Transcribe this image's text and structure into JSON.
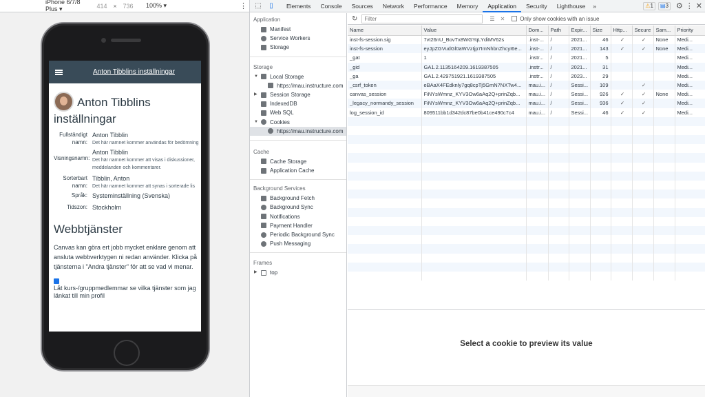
{
  "emulation": {
    "device": "iPhone 6/7/8 Plus ▾",
    "width": "414",
    "x": "×",
    "height": "736",
    "zoom": "100% ▾"
  },
  "phone_page": {
    "header_title": "Anton Tibblins inställningar",
    "title_line1": "Anton Tibblins",
    "title_line2": "inställningar",
    "fields": [
      {
        "label": "Fullständigt namn:",
        "value": "Anton Tibblin",
        "hint": "Det här namnet kommer användas för bedömning"
      },
      {
        "label": "Visningsnamn:",
        "value": "Anton Tibblin",
        "hint": "Det här namnet kommer att visas i diskussioner, meddelanden och kommentarer."
      },
      {
        "label": "Sorterbart namn:",
        "value": "Tibblin, Anton",
        "hint": "Det här namnet kommer att synas i sorterade lis"
      },
      {
        "label": "Språk:",
        "value": "Systeminställning (Svenska)",
        "hint": ""
      },
      {
        "label": "Tidszon:",
        "value": "Stockholm",
        "hint": ""
      }
    ],
    "web_heading": "Webbtjänster",
    "web_text_1": "Canvas kan göra ert jobb mycket enklare genom att",
    "web_text_2": "ansluta webbverktygen ni redan använder. Klicka på",
    "web_text_3": "tjänsterna i \"Andra tjänster\" för att se vad vi menar.",
    "checkbox_label_1": "Låt kurs-/gruppmedlemmar se vilka tjänster som jag",
    "checkbox_label_2": "länkat till min profil"
  },
  "devtools": {
    "tabs": [
      "Elements",
      "Console",
      "Sources",
      "Network",
      "Performance",
      "Memory",
      "Application",
      "Security",
      "Lighthouse"
    ],
    "more": "»",
    "warnings": "1",
    "messages": "3",
    "active_tab": "Application",
    "sidebar": {
      "application_header": "Application",
      "application_items": [
        "Manifest",
        "Service Workers",
        "Storage"
      ],
      "storage_header": "Storage",
      "local_storage": "Local Storage",
      "local_storage_child": "https://mau.instructure.com",
      "session_storage": "Session Storage",
      "indexeddb": "IndexedDB",
      "websql": "Web SQL",
      "cookies": "Cookies",
      "cookies_child": "https://mau.instructure.com",
      "cache_header": "Cache",
      "cache_items": [
        "Cache Storage",
        "Application Cache"
      ],
      "bg_header": "Background Services",
      "bg_items": [
        "Background Fetch",
        "Background Sync",
        "Notifications",
        "Payment Handler",
        "Periodic Background Sync",
        "Push Messaging"
      ],
      "frames_header": "Frames",
      "frames_top": "top"
    },
    "filter_placeholder": "Filter",
    "only_issue_label": "Only show cookies with an issue",
    "columns": [
      "Name",
      "Value",
      "Dom...",
      "Path",
      "Expir...",
      "Size",
      "Http...",
      "Secure",
      "Sam...",
      "Priority"
    ],
    "cookies": [
      [
        "inst-fs-session.sig",
        "7vt26nU_BovTx8WGYqLYdiMV62s",
        ".inst-...",
        "/",
        "2021...",
        "46",
        "✓",
        "✓",
        "None",
        "Medi..."
      ],
      [
        "inst-fs-session",
        "eyJpZGVudGl0aWVzIjp7ImNhbnZhcyI6e...",
        ".inst-...",
        "/",
        "2021...",
        "143",
        "✓",
        "✓",
        "None",
        "Medi..."
      ],
      [
        "_gat",
        "1",
        ".instr...",
        "/",
        "2021...",
        "5",
        "",
        "",
        "",
        "Medi..."
      ],
      [
        "_gid",
        "GA1.2.1135164209.1619387505",
        ".instr...",
        "/",
        "2021...",
        "31",
        "",
        "",
        "",
        "Medi..."
      ],
      [
        "_ga",
        "GA1.2.429751921.1619387505",
        ".instr...",
        "/",
        "2023...",
        "29",
        "",
        "",
        "",
        "Medi..."
      ],
      [
        "_csrf_token",
        "eBAaX4FEdknly7gq8cpTj5GmN7NXTw4...",
        "mau.i...",
        "/",
        "Sessi...",
        "109",
        "",
        "✓",
        "",
        "Medi..."
      ],
      [
        "canvas_session",
        "FiNYsWmnz_KYV3Ow6aAq2Q+prinZqb...",
        "mau.i...",
        "/",
        "Sessi...",
        "926",
        "✓",
        "✓",
        "None",
        "Medi..."
      ],
      [
        "_legacy_normandy_session",
        "FiNYsWmnz_KYV3Ow6aAq2Q+prinZqb...",
        "mau.i...",
        "/",
        "Sessi...",
        "936",
        "✓",
        "✓",
        "",
        "Medi..."
      ],
      [
        "log_session_id",
        "809511bb1d342dc87be0b41ce490c7c4",
        "mau.i...",
        "/",
        "Sessi...",
        "46",
        "✓",
        "✓",
        "",
        "Medi..."
      ]
    ],
    "preview_text": "Select a cookie to preview its value"
  }
}
